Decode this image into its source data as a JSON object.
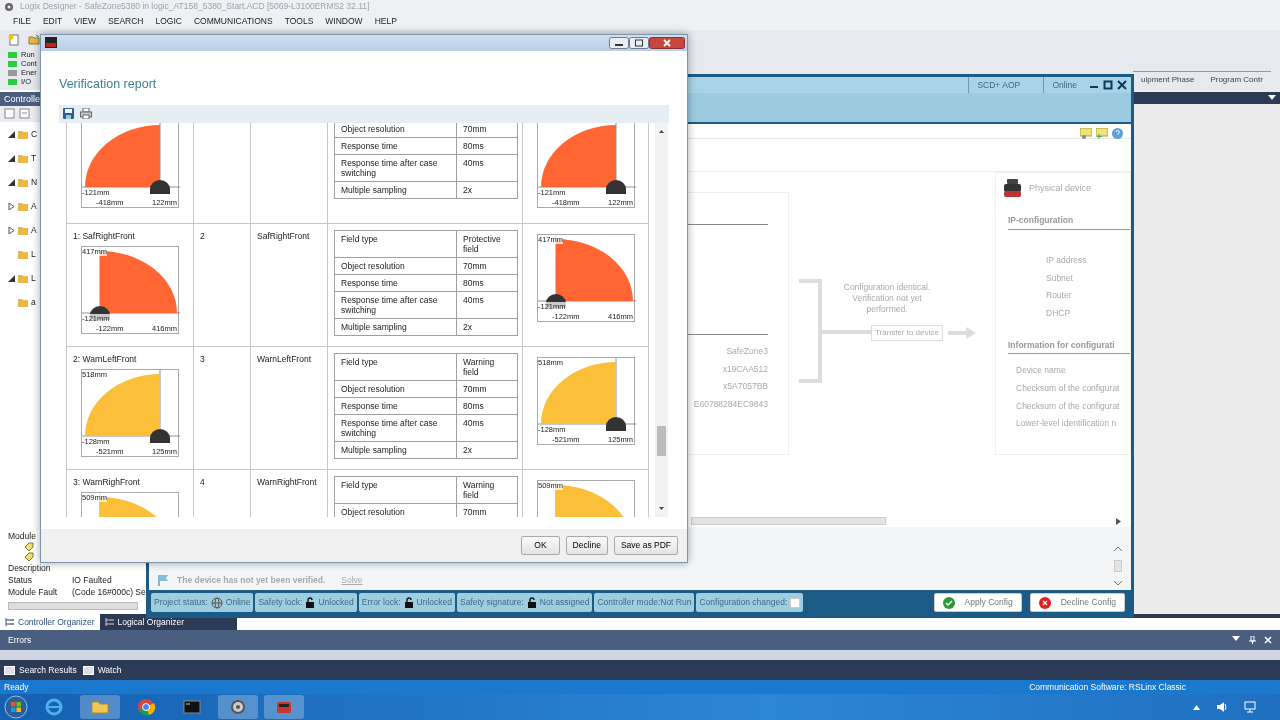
{
  "app": {
    "title": "Logix Designer - SafeZone5380 in logic_AT158_5380_Start.ACD [5069-L3100ERMS2 32.11]",
    "menu": [
      "FILE",
      "EDIT",
      "VIEW",
      "SEARCH",
      "LOGIC",
      "COMMUNICATIONS",
      "TOOLS",
      "WINDOW",
      "HELP"
    ],
    "controller_status": [
      {
        "label": "Run",
        "color": "#2ecc40"
      },
      {
        "label": "Cont",
        "color": "#2ecc40"
      },
      {
        "label": "Ener",
        "color": "#9a9a9a"
      },
      {
        "label": "I/O",
        "color": "#2ecc40"
      }
    ],
    "document_tabs": [
      "uipment Phase",
      "Program Contr"
    ]
  },
  "organizer": {
    "title": "Controlle",
    "tree": [
      {
        "label": "C",
        "expanded": true
      },
      {
        "label": "T",
        "expanded": true
      },
      {
        "label": "N",
        "expanded": true
      },
      {
        "label": "A",
        "expanded": false
      },
      {
        "label": "A",
        "expanded": false
      },
      {
        "label": "L"
      },
      {
        "label": "L",
        "expanded": true
      },
      {
        "label": "a"
      }
    ],
    "module_title": "Module",
    "properties": [
      {
        "label": "Description"
      },
      {
        "label": "Status",
        "value": "IO Faulted"
      },
      {
        "label": "Module Fault",
        "value": "(Code 16#000c) Se"
      }
    ],
    "tabs": [
      {
        "label": "Controller Organizer",
        "selected": true
      },
      {
        "label": "Logical Organizer",
        "selected": false
      }
    ]
  },
  "aop_window": {
    "title_cells": [
      "SCD+ AOP",
      "Online"
    ],
    "configured_values": [
      "SafeZone3",
      "x19CAA512",
      "x5A7057BB",
      "E60788284EC9843"
    ],
    "compare_text": "Configuration identical. Verification not yet performed.",
    "transfer_button": "Transfer to device",
    "device_panel": {
      "title": "Physical device",
      "sections": [
        {
          "heading": "IP-configuration",
          "fields": [
            "IP address",
            "Subnet",
            "Router",
            "DHCP"
          ]
        },
        {
          "heading": "Information for configurati",
          "fields": [
            "Device name",
            "Checksum of the configurat",
            "Checksum of the configurat",
            "Lower-level identification n"
          ]
        }
      ]
    },
    "notice": {
      "text": "The device has not yet been verified.",
      "link": "Solve"
    },
    "status_chips": [
      {
        "kind": "globe",
        "label": "Project status:",
        "value": "Online"
      },
      {
        "kind": "lock",
        "label": "Safety lock:",
        "value": "Unlocked"
      },
      {
        "kind": "lock",
        "label": "Error lock:",
        "value": "Unlocked"
      },
      {
        "kind": "lock",
        "label": "Safety signature:",
        "value": "Not assigned"
      },
      {
        "kind": "text",
        "label": "Controller mode:Not Run"
      },
      {
        "kind": "checkbox",
        "label": "Configuration changed:",
        "checked": false
      }
    ],
    "buttons": [
      {
        "kind": "apply",
        "label": "Apply Config"
      },
      {
        "kind": "decline",
        "label": "Decline Config"
      }
    ]
  },
  "dialog": {
    "heading": "Verification report",
    "rows": [
      {
        "properties": [
          {
            "name": "Object resolution",
            "value": "70mm"
          },
          {
            "name": "Response time",
            "value": "80ms"
          },
          {
            "name": "Response time after case switching",
            "value": "40ms"
          },
          {
            "name": "Multiple sampling",
            "value": "2x"
          }
        ],
        "left_field": {
          "kind": "left",
          "color": "#ff6633",
          "labels": {
            "y_min": "-121mm",
            "x_min": "-418mm",
            "x_max": "122mm"
          }
        },
        "right_field": {
          "kind": "left",
          "color": "#ff6633",
          "labels": {
            "y_min": "-121mm",
            "x_min": "-418mm",
            "x_max": "122mm"
          }
        }
      },
      {
        "label": "1: SafRightFront",
        "index": "2",
        "name": "SafRightFront",
        "properties": [
          {
            "name": "Field type",
            "value": "Protective field"
          },
          {
            "name": "Object resolution",
            "value": "70mm"
          },
          {
            "name": "Response time",
            "value": "80ms"
          },
          {
            "name": "Response time after case switching",
            "value": "40ms"
          },
          {
            "name": "Multiple sampling",
            "value": "2x"
          }
        ],
        "left_field": {
          "kind": "right",
          "color": "#ff6633",
          "labels": {
            "top": "417mm",
            "y_min": "-121mm",
            "x_min": "-122mm",
            "x_max": "416mm"
          }
        },
        "right_field": {
          "kind": "right",
          "color": "#ff6633",
          "labels": {
            "top": "417mm",
            "y_min": "-121mm",
            "x_min": "-122mm",
            "x_max": "416mm"
          }
        }
      },
      {
        "label": "2: WarnLeftFront",
        "index": "3",
        "name": "WarnLeftFront",
        "properties": [
          {
            "name": "Field type",
            "value": "Warning field"
          },
          {
            "name": "Object resolution",
            "value": "70mm"
          },
          {
            "name": "Response time",
            "value": "80ms"
          },
          {
            "name": "Response time after case switching",
            "value": "40ms"
          },
          {
            "name": "Multiple sampling",
            "value": "2x"
          }
        ],
        "left_field": {
          "kind": "left",
          "color": "#fbbf3a",
          "labels": {
            "top": "518mm",
            "y_min": "-128mm",
            "x_min": "-521mm",
            "x_max": "125mm"
          }
        },
        "right_field": {
          "kind": "left",
          "color": "#fbbf3a",
          "labels": {
            "top": "518mm",
            "y_min": "-128mm",
            "x_min": "-521mm",
            "x_max": "125mm"
          }
        }
      },
      {
        "label": "3: WarnRighFront",
        "index": "4",
        "name": "WarnRightFront",
        "properties": [
          {
            "name": "Field type",
            "value": "Warning field"
          },
          {
            "name": "Object resolution",
            "value": "70mm"
          }
        ],
        "left_field": {
          "kind": "right",
          "color": "#fbbf3a",
          "labels": {
            "top": "509mm"
          }
        },
        "right_field": {
          "kind": "right",
          "color": "#fbbf3a",
          "labels": {
            "top": "509mm"
          }
        }
      }
    ],
    "buttons": [
      "OK",
      "Decline",
      "Save as PDF"
    ]
  },
  "output_panel": {
    "title": "Errors",
    "tabs": [
      "Search Results",
      "Watch"
    ]
  },
  "status_bar": {
    "left": "Ready",
    "right": "Communication Software: RSLinx Classic"
  }
}
